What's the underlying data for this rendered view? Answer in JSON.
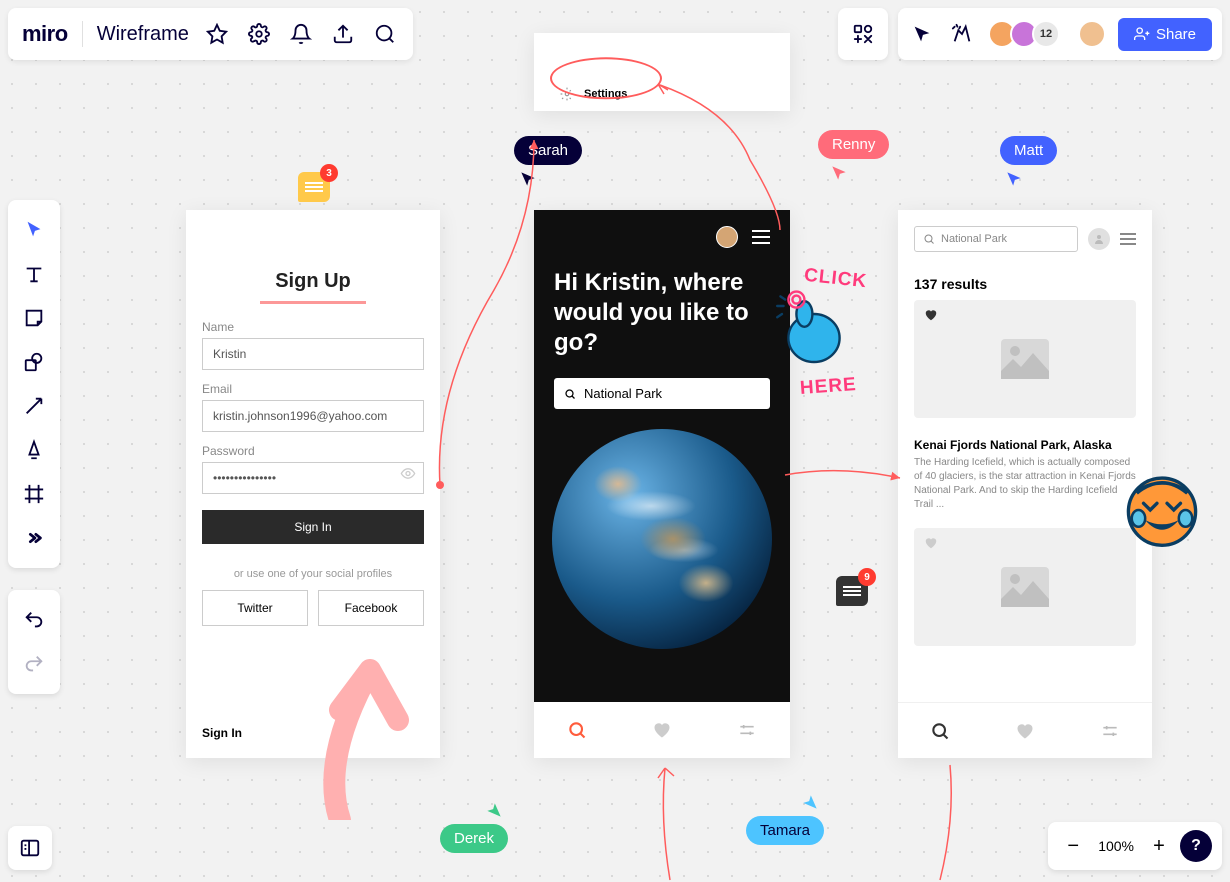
{
  "app": {
    "logo": "miro",
    "board_name": "Wireframe"
  },
  "topbar": {
    "avatar_count": "12",
    "share_label": "Share"
  },
  "zoom": {
    "level": "100%"
  },
  "frame1": {
    "title": "Sign Up",
    "name_label": "Name",
    "name_value": "Kristin",
    "email_label": "Email",
    "email_value": "kristin.johnson1996@yahoo.com",
    "password_label": "Password",
    "password_value": "•••••••••••••••",
    "signin_btn": "Sign In",
    "or_text": "or use one of your social profiles",
    "twitter": "Twitter",
    "facebook": "Facebook",
    "bottom_signin": "Sign In"
  },
  "frame2": {
    "settings_label": "Settings"
  },
  "frame3": {
    "greeting": "Hi Kristin, where would you like to go?",
    "search_value": "National Park"
  },
  "frame4": {
    "search_placeholder": "National Park",
    "results_text": "137 results",
    "result_title": "Kenai Fjords National Park, Alaska",
    "result_desc": "The Harding Icefield, which is actually composed of 40 glaciers, is the star attraction in Kenai Fjords National Park. And to skip the Harding Icefield Trail ..."
  },
  "cursors": {
    "sarah": "Sarah",
    "renny": "Renny",
    "matt": "Matt",
    "derek": "Derek",
    "tamara": "Tamara"
  },
  "comments": {
    "c1": "3",
    "c2": "9"
  },
  "sticker": {
    "click1": "CLICK",
    "click2": "HERE"
  },
  "colors": {
    "primary": "#4262FF",
    "sarah": "#050038",
    "renny": "#ff6b7a",
    "matt": "#4262FF",
    "derek": "#3cc988",
    "tamara": "#4dc4ff"
  }
}
